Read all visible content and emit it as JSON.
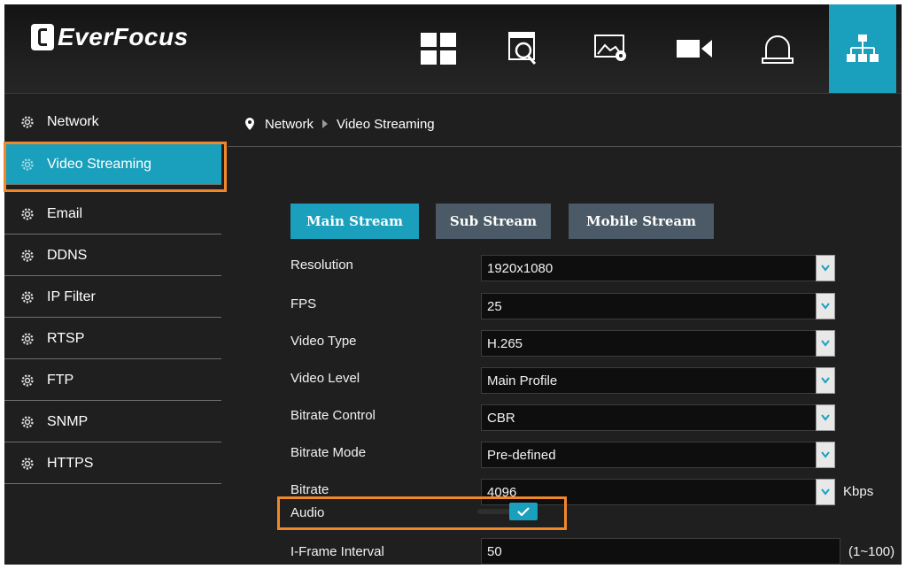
{
  "app": {
    "brand": "EverFocus"
  },
  "top_nav": [
    {
      "name": "live-view",
      "icon": "grid-icon"
    },
    {
      "name": "playback",
      "icon": "search-video-icon"
    },
    {
      "name": "image",
      "icon": "image-settings-icon"
    },
    {
      "name": "camera",
      "icon": "camera-icon"
    },
    {
      "name": "alarm",
      "icon": "alarm-bell-icon"
    },
    {
      "name": "network",
      "icon": "network-icon",
      "active": true
    }
  ],
  "sidebar": {
    "items": [
      {
        "label": "Network"
      },
      {
        "label": "Video Streaming",
        "active": true
      },
      {
        "label": "Email"
      },
      {
        "label": "DDNS"
      },
      {
        "label": "IP Filter"
      },
      {
        "label": "RTSP"
      },
      {
        "label": "FTP"
      },
      {
        "label": "SNMP"
      },
      {
        "label": "HTTPS"
      }
    ]
  },
  "breadcrumb": {
    "parent": "Network",
    "current": "Video Streaming"
  },
  "tabs": [
    {
      "label": "Main Stream",
      "active": true
    },
    {
      "label": "Sub Stream"
    },
    {
      "label": "Mobile Stream"
    }
  ],
  "form": {
    "resolution": {
      "label": "Resolution",
      "value": "1920x1080"
    },
    "fps": {
      "label": "FPS",
      "value": "25"
    },
    "video_type": {
      "label": "Video Type",
      "value": "H.265"
    },
    "video_level": {
      "label": "Video Level",
      "value": "Main Profile"
    },
    "bitrate_control": {
      "label": "Bitrate Control",
      "value": "CBR"
    },
    "bitrate_mode": {
      "label": "Bitrate Mode",
      "value": "Pre-defined"
    },
    "bitrate": {
      "label": "Bitrate",
      "value": "4096",
      "unit": "Kbps"
    },
    "audio": {
      "label": "Audio",
      "enabled": true
    },
    "iframe_interval": {
      "label": "I-Frame Interval",
      "value": "50",
      "range": "(1~100)"
    }
  },
  "colors": {
    "accent": "#1aa0bd",
    "highlight": "#f0882a",
    "background": "#1f1f1f"
  }
}
